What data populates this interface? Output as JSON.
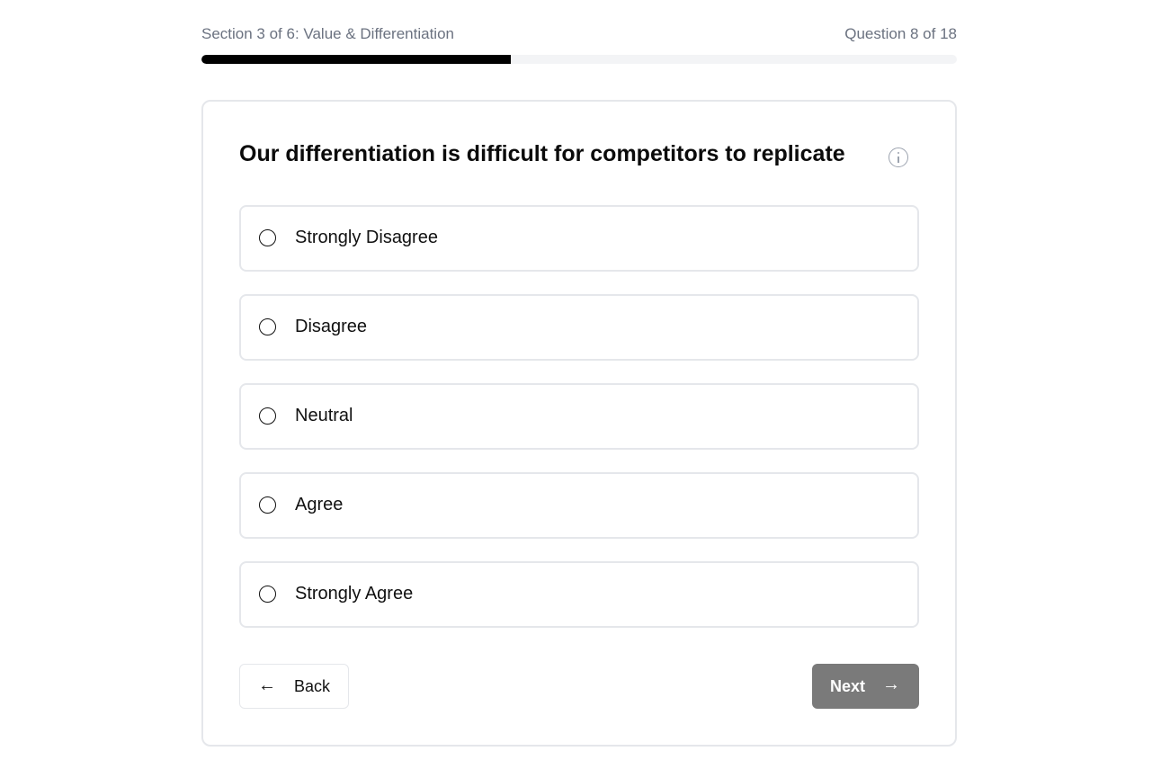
{
  "progress": {
    "section_text": "Section 3 of 6: Value & Differentiation",
    "question_counter": "Question 8 of 18",
    "fraction": 0.41
  },
  "question": {
    "text": "Our differentiation is difficult for competitors to replicate",
    "info_icon": "info-circle-icon"
  },
  "options": [
    {
      "label": "Strongly Disagree",
      "selected": false
    },
    {
      "label": "Disagree",
      "selected": false
    },
    {
      "label": "Neutral",
      "selected": false
    },
    {
      "label": "Agree",
      "selected": false
    },
    {
      "label": "Strongly Agree",
      "selected": false
    }
  ],
  "navigation": {
    "back_label": "Back",
    "back_icon": "arrow-left-icon",
    "next_label": "Next",
    "next_icon": "arrow-right-icon",
    "next_enabled": false
  },
  "colors": {
    "progress_fill": "#000000",
    "progress_track": "#f3f4f6",
    "next_disabled_bg": "#7a7a7a",
    "border": "#e5e7eb"
  }
}
